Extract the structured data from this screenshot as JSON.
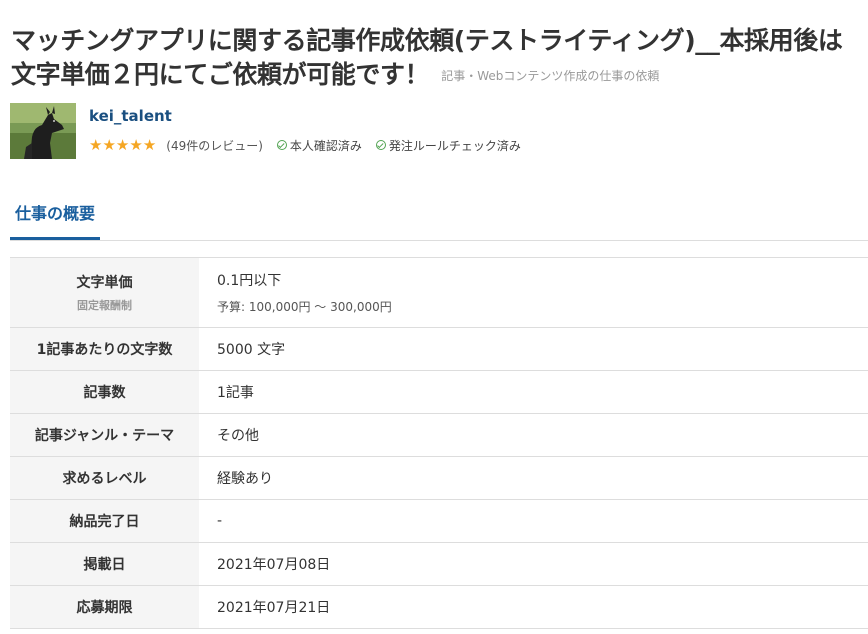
{
  "job": {
    "title": "マッチングアプリに関する記事作成依頼(テストライティング)__本採用後は文字単価２円にてご依頼が可能です！",
    "category": "記事・Webコンテンツ作成の仕事の依頼"
  },
  "client": {
    "username": "kei_talent",
    "rating": 5,
    "review_count": "(49件のレビュー)",
    "badges": [
      "本人確認済み",
      "発注ルールチェック済み"
    ]
  },
  "tabs": {
    "active": "仕事の概要"
  },
  "details": {
    "unit_price_label": "文字単価",
    "unit_price_sub": "固定報酬制",
    "unit_price_value": "0.1円以下",
    "budget": "予算: 100,000円 〜 300,000円",
    "rows": [
      {
        "label": "1記事あたりの文字数",
        "value": "5000 文字"
      },
      {
        "label": "記事数",
        "value": "1記事"
      },
      {
        "label": "記事ジャンル・テーマ",
        "value": "その他"
      },
      {
        "label": "求めるレベル",
        "value": "経験あり"
      },
      {
        "label": "納品完了日",
        "value": "-"
      },
      {
        "label": "掲載日",
        "value": "2021年07月08日"
      },
      {
        "label": "応募期限",
        "value": "2021年07月21日"
      }
    ]
  },
  "colors": {
    "accent": "#1a5f9e",
    "username": "#1a4f80",
    "star": "#f5a623",
    "check": "#52a352"
  }
}
